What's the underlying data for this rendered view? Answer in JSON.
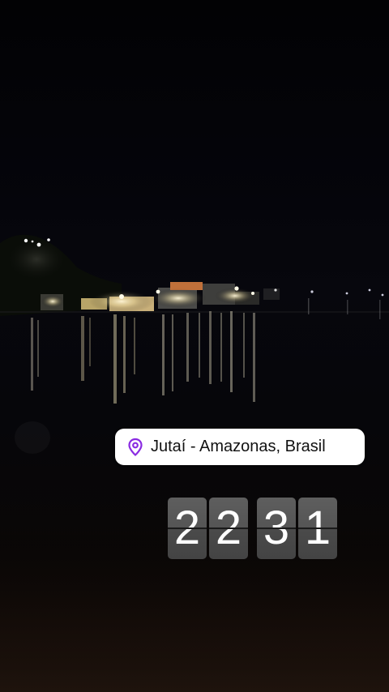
{
  "location_sticker": {
    "icon": "location-pin-icon",
    "text": "Jutaí - Amazonas, Brasil",
    "icon_color": "#8a2be2"
  },
  "clock_sticker": {
    "digits": [
      "2",
      "2",
      "3",
      "1"
    ]
  }
}
